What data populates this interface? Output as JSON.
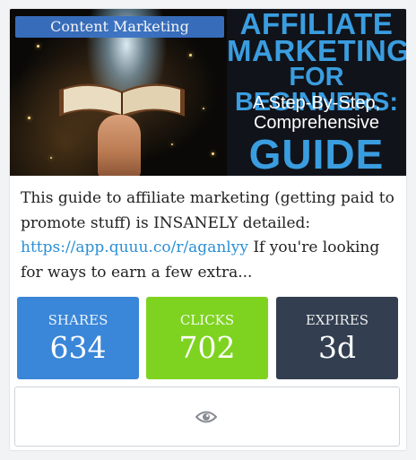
{
  "card": {
    "category": "Content Marketing",
    "image_text": {
      "line1": "AFFILIATE",
      "line2": "MARKETING",
      "line3": "FOR BEGINNERS:",
      "line4": "A Step-By-Step,",
      "line5": "Comprehensive",
      "line6": "GUIDE"
    },
    "body": {
      "text_before": "This guide to affiliate marketing (getting paid to promote stuff) is INSANELY detailed: ",
      "link": "https://app.quuu.co/r/aganlyy",
      "text_after": " If you're looking for ways to earn a few extra..."
    },
    "stats": {
      "shares_label": "SHARES",
      "shares_value": "634",
      "clicks_label": "CLICKS",
      "clicks_value": "702",
      "expires_label": "EXPIRES",
      "expires_value": "3d"
    },
    "view_icon": "eye-icon"
  },
  "colors": {
    "category_badge": "#3a72c4",
    "shares": "#3a86d8",
    "clicks": "#7ed321",
    "expires": "#333f50",
    "link": "#2a8fd6",
    "image_title": "#3a9de0"
  }
}
